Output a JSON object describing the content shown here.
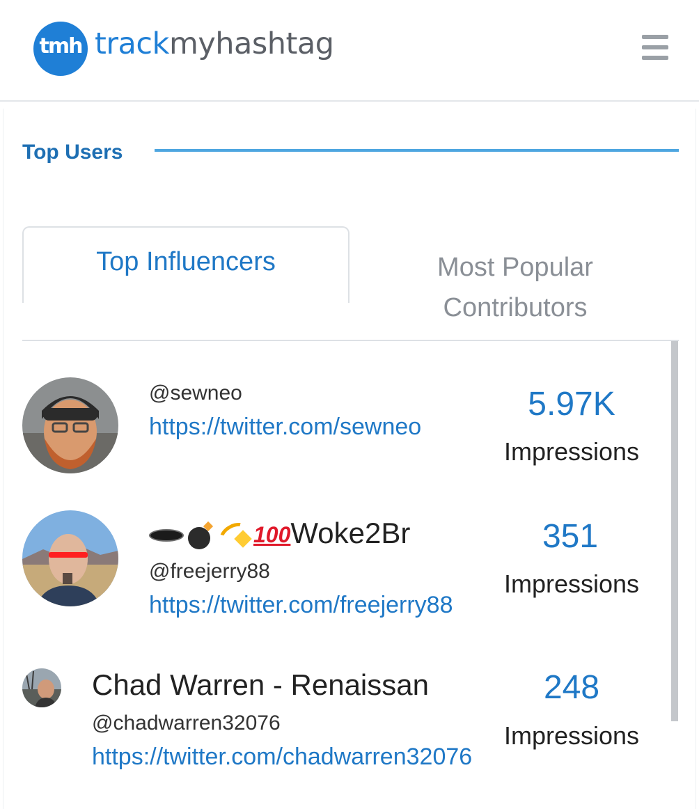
{
  "header": {
    "logo_text": "tmh",
    "brand_part1": "track",
    "brand_part2": "myhashtag",
    "menu_icon": "hamburger-icon"
  },
  "section": {
    "title": "Top Users"
  },
  "tabs": [
    {
      "label": "Top Influencers",
      "active": true
    },
    {
      "label": "Most Popular Contributors",
      "active": false
    }
  ],
  "users": [
    {
      "display_name": "",
      "handle": "@sewneo",
      "url": "https://twitter.com/sewneo",
      "impressions": "5.97K",
      "impressions_label": "Impressions"
    },
    {
      "display_name": "🕳️💣💫💯Woke2Br",
      "name_text": "Woke2Br",
      "emoji_icons": [
        "hole-icon",
        "bomb-icon",
        "dizzy-icon",
        "hundred-icon"
      ],
      "handle": "@freejerry88",
      "url": "https://twitter.com/freejerry88",
      "impressions": "351",
      "impressions_label": "Impressions"
    },
    {
      "display_name": "Chad Warren - Renaissan",
      "handle": "@chadwarren32076",
      "url": "https://twitter.com/chadwarren32076",
      "impressions": "248",
      "impressions_label": "Impressions"
    }
  ],
  "colors": {
    "accent": "#1f78c6",
    "logo": "#1f7fd6",
    "rule": "#4ea6e0",
    "muted": "#8a8f96"
  }
}
